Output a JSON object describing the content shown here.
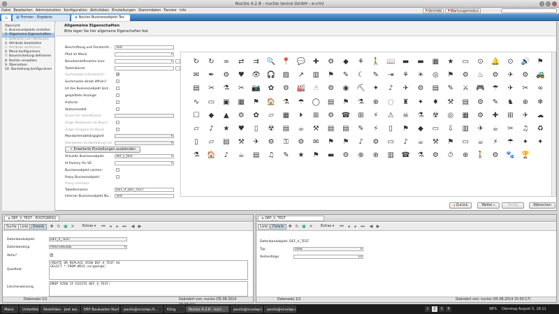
{
  "window": {
    "title": "Nuclos 4.2.8 - nuclos (evice GmbH - e-cm)"
  },
  "menu": {
    "items": [
      "Datei",
      "Bearbeiten",
      "Administration",
      "Konfiguration",
      "Aktivitäten",
      "Einstellungen",
      "Stammdaten",
      "Fenster",
      "Info"
    ],
    "right_buttons": [
      "Vertrieb",
      "Wartungsmodus"
    ]
  },
  "tabs": [
    {
      "label": "Formen - Ergebnis"
    },
    {
      "label": "Nuclos Businessobjekt Tes"
    }
  ],
  "steps": {
    "title": "Übersicht",
    "items": [
      {
        "label": "1. Businessobjekte erstellen",
        "state": "normal"
      },
      {
        "label": "2. Allgemeine Eigenschaften",
        "state": "selected"
      },
      {
        "label": "3. Definition von Attributen",
        "state": "disabled"
      },
      {
        "label": "4. Attribute bearbeiten",
        "state": "normal"
      },
      {
        "label": "5. Attribute verfeinern",
        "state": "disabled"
      },
      {
        "label": "6. Menü konfigurieren",
        "state": "normal"
      },
      {
        "label": "7. Bauminstellung definieren",
        "state": "normal"
      },
      {
        "label": "8. Rechte verwalten",
        "state": "normal"
      },
      {
        "label": "9. Übersetzen",
        "state": "normal"
      },
      {
        "label": "10. Darstellung konfigurieren",
        "state": "normal"
      }
    ]
  },
  "step_header": {
    "title": "Allgemeine Eigenschaften",
    "subtitle": "Bitte legen Sie hier allgemeine Eigenschaften fest"
  },
  "form": {
    "name_label": "Beschriftung und Fenstertit...",
    "name_value": "Test",
    "menu_path_label": "Pfad im Menü",
    "icon_label": "Benutzerdefiniertes Icon:",
    "shortcut_label": "Tastenkürzel",
    "search_required_label": "Suchmaske erforderlich?",
    "search_open_label": "Suchmaske direkt öffnen?",
    "is_bo_label": "Ist das Businessobjekt änd...",
    "split_view_label": "gesplittete Anzeige:",
    "history_label": "Historie:",
    "status_model_label": "Statusmodell:",
    "identifier_label": "Kürzel für Identifizierer",
    "show_relations_label": "Zeige Relationen im Baum",
    "show_groups_label": "Zeige Gruppen im Baum",
    "client_dependent_label": "Mandantenabhängigkeit",
    "client_created_label": "Mandanten Erstbefüllung mit",
    "expand_button": "Erweiterte Einstellungen ausblenden",
    "virtual_bo_label": "Virtuelle Businessobjekt:",
    "virtual_bo_value": "def_v_test",
    "id_factory_label": "Id Factory für VE:",
    "cache_label": "Businessobjekt cachen:",
    "proxy_label": "Proxy Businessobjekt:",
    "proxy_interface_label": "Proxy Interface",
    "table_name_label": "Tabellenname:",
    "table_name_value": "DEF_V_DEF_TEST",
    "internal_name_label": "Interner Businessobjekt Na...",
    "internal_name_value": "Test",
    "icons_label": "Icon:"
  },
  "wizard_buttons": {
    "back": "Zurück",
    "next": "Weiter",
    "finish": "Fertig",
    "cancel": "Abbrechen"
  },
  "left_pane": {
    "title": "DEF_V_TEST - POSTGRESQ",
    "toolbar": {
      "search": "Suche",
      "list": "Liste",
      "details": "Details",
      "extras": "Extras"
    },
    "fields": {
      "db_object_label": "Datenbankobjekt",
      "db_object_value": "DEF_V_TEST",
      "db_type_label": "Datenbanktyp",
      "db_type_value": "POSTGRESQL",
      "active_label": "Aktiv?",
      "source_label": "Quelltext",
      "source_value": "CREATE OR REPLACE VIEW DEF_V_TEST AS\nSELECT * FROM WEV1_vorgaenge;",
      "drop_label": "Löschanweisung",
      "drop_value": "DROP VIEW IF EXISTS DEF_V_TEST;"
    },
    "status_left": "Datensatz 1/1",
    "status_right": "Geändert von: nuclos (05.08.2014 15:03:41)"
  },
  "right_pane": {
    "title": "DEF_V_TEST",
    "toolbar": {
      "list": "Liste",
      "details": "Details",
      "extras": "Extras"
    },
    "fields": {
      "db_object_label": "Datenbankobjekt",
      "db_object_value": "DEF_V_TEST",
      "type_label": "Typ",
      "type_value": "view",
      "order_label": "Reihenfolge",
      "order_value": "10"
    },
    "status_left": "Datensatz 1/1",
    "status_right": "Geändert von: nuclos (05.08.2014 15:03:17)"
  },
  "taskbar": {
    "items": [
      "Menü",
      "Untertitel",
      "NewVideo - Jest wa...",
      "ERP Baukasten Nucl...",
      "pavlis@vcsslap:/h...",
      "Kling",
      "Nuclos 4.2.8 - nucl...",
      "pavlis@vcsslap:/h...",
      "pavlis@vcsslap:/h..."
    ],
    "workspaces": [
      "1",
      "2",
      "3",
      "4"
    ],
    "clock": "Dienstag August 5, 18:11",
    "battery": "98%"
  },
  "icon_symbols": [
    "↻",
    "↻",
    "∞",
    "⇄",
    "⇉",
    "🔍",
    "📍",
    "💬",
    "✚",
    "⚙",
    "◆",
    "⚘",
    "🚶",
    "📖",
    "▬",
    "▬",
    "▦",
    "★",
    "▭",
    "⊙",
    "🔔",
    "⊙",
    "🔊",
    "⚑",
    "✉",
    "✒",
    "⚙",
    "♥",
    "👁",
    "🎧",
    "▨",
    "↗",
    "▥",
    "⚑",
    "✎",
    "☾",
    "✎",
    "⇥",
    "⚘",
    "☀",
    "◎",
    "⚑",
    "⚙",
    "♨",
    "⚙",
    "✈",
    "⚙",
    "🚜",
    "▤",
    "✂",
    "⚗",
    "✂",
    "📷",
    "✿",
    "⚙",
    "🏭",
    "☝",
    "⚙",
    "◉",
    "⛏",
    "✦",
    "♪",
    "✈",
    "⚙",
    "▤",
    "✎",
    "⚔",
    "🎮",
    "☂",
    "✈",
    "✂",
    "∞",
    "∿",
    "▭",
    "▣",
    "▦",
    "⚑",
    "🏠",
    "⚗",
    "☂",
    "◯",
    "▤",
    "⚑",
    "⚗",
    "⊕",
    "◌",
    "♜",
    "✦",
    "♦",
    "⚒",
    "▤",
    "⚙",
    "✎",
    "♞",
    "⊕",
    "❄",
    "☐",
    "◆",
    "▲",
    "⚙",
    "✿",
    "▱",
    "▦",
    "⏵",
    "⊞",
    "⚙",
    "☎",
    "⊞",
    "⚡",
    "⚠",
    "☠",
    "⚗",
    "☢",
    "◎",
    "▦",
    "⚙",
    "✚",
    "⊞",
    "✈",
    "☁",
    "▱",
    "♪",
    "★",
    "♥",
    "▯",
    "☢",
    "▤",
    "☕",
    "⚒",
    "▤",
    "▤",
    "✎",
    "⚡",
    "▯",
    "⚑",
    "◆",
    "▭",
    "⇩",
    "▥",
    "✈",
    "☕",
    "✂",
    "♫",
    "♻",
    "▯",
    "▱",
    "▤",
    "⚒",
    "✈",
    "⚙",
    "⚿",
    "⚙",
    "✉",
    "⚑",
    "⚑",
    "♪",
    "⚙",
    "▭",
    "♪",
    "☕",
    "⚒",
    "⚑",
    "▭",
    "☕",
    "⚡",
    "☂",
    "✦",
    "✦",
    "⚗",
    "🏠",
    "♪",
    "☕",
    "▤",
    "♫",
    "✎",
    "★",
    "⚑",
    "▬",
    "⚙",
    "⊕",
    "⊕",
    "▥",
    "☎",
    "⚗",
    "⚙",
    "⏱",
    "⊕",
    "🚶",
    "⚙",
    "🐾",
    "🏆"
  ]
}
